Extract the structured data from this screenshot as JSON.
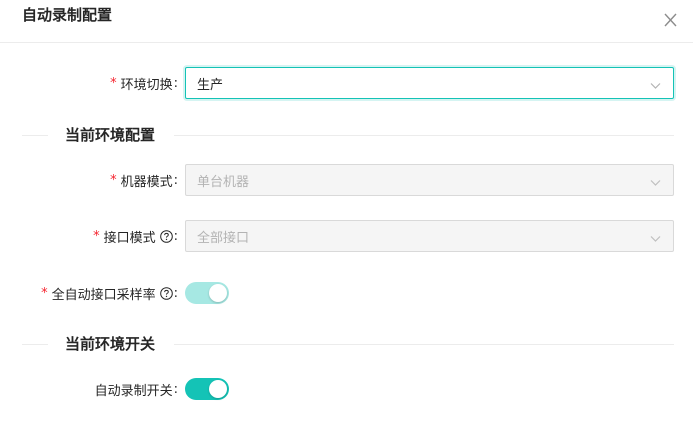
{
  "dialog": {
    "title": "自动录制配置",
    "close_label": "X"
  },
  "env": {
    "label": "环境切换",
    "required": "*",
    "colon": ":",
    "value": "生产"
  },
  "section_current_config": {
    "title": "当前环境配置"
  },
  "machine_mode": {
    "label": "机器模式",
    "required": "*",
    "colon": ":",
    "value": "单台机器"
  },
  "interface_mode": {
    "label": "接口模式",
    "required": "*",
    "colon": ":",
    "value": "全部接口"
  },
  "sampling_rate": {
    "label": "全自动接口采样率",
    "required": "*",
    "colon": ":",
    "enabled": true,
    "disabled_state": true
  },
  "section_current_switch": {
    "title": "当前环境开关"
  },
  "auto_record": {
    "label": "自动录制开关",
    "colon": ":",
    "enabled": true
  },
  "colors": {
    "accent": "#14c3b6",
    "accent_disabled": "#a6e8e3",
    "required": "#f5222d"
  }
}
